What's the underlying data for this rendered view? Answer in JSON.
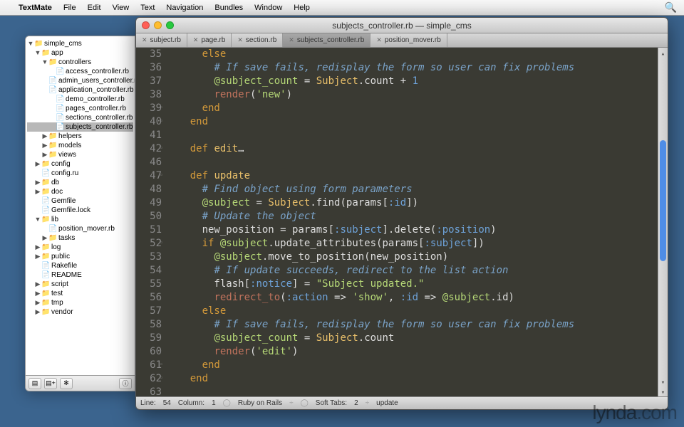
{
  "menubar": {
    "app_name": "TextMate",
    "items": [
      "File",
      "Edit",
      "View",
      "Text",
      "Navigation",
      "Bundles",
      "Window",
      "Help"
    ]
  },
  "drawer": {
    "tree": [
      {
        "d": 0,
        "arrow": "▼",
        "icon": "📁",
        "label": "simple_cms"
      },
      {
        "d": 1,
        "arrow": "▼",
        "icon": "📁",
        "label": "app"
      },
      {
        "d": 2,
        "arrow": "▼",
        "icon": "📁",
        "label": "controllers"
      },
      {
        "d": 3,
        "arrow": "",
        "icon": "📄",
        "label": "access_controller.rb"
      },
      {
        "d": 3,
        "arrow": "",
        "icon": "📄",
        "label": "admin_users_controller.rb"
      },
      {
        "d": 3,
        "arrow": "",
        "icon": "📄",
        "label": "application_controller.rb"
      },
      {
        "d": 3,
        "arrow": "",
        "icon": "📄",
        "label": "demo_controller.rb"
      },
      {
        "d": 3,
        "arrow": "",
        "icon": "📄",
        "label": "pages_controller.rb"
      },
      {
        "d": 3,
        "arrow": "",
        "icon": "📄",
        "label": "sections_controller.rb"
      },
      {
        "d": 3,
        "arrow": "",
        "icon": "📄",
        "label": "subjects_controller.rb",
        "selected": true
      },
      {
        "d": 2,
        "arrow": "▶",
        "icon": "📁",
        "label": "helpers"
      },
      {
        "d": 2,
        "arrow": "▶",
        "icon": "📁",
        "label": "models"
      },
      {
        "d": 2,
        "arrow": "▶",
        "icon": "📁",
        "label": "views"
      },
      {
        "d": 1,
        "arrow": "▶",
        "icon": "📁",
        "label": "config"
      },
      {
        "d": 1,
        "arrow": "",
        "icon": "📄",
        "label": "config.ru"
      },
      {
        "d": 1,
        "arrow": "▶",
        "icon": "📁",
        "label": "db"
      },
      {
        "d": 1,
        "arrow": "▶",
        "icon": "📁",
        "label": "doc"
      },
      {
        "d": 1,
        "arrow": "",
        "icon": "📄",
        "label": "Gemfile"
      },
      {
        "d": 1,
        "arrow": "",
        "icon": "📄",
        "label": "Gemfile.lock"
      },
      {
        "d": 1,
        "arrow": "▼",
        "icon": "📁",
        "label": "lib"
      },
      {
        "d": 2,
        "arrow": "",
        "icon": "📄",
        "label": "position_mover.rb"
      },
      {
        "d": 2,
        "arrow": "▶",
        "icon": "📁",
        "label": "tasks"
      },
      {
        "d": 1,
        "arrow": "▶",
        "icon": "📁",
        "label": "log"
      },
      {
        "d": 1,
        "arrow": "▶",
        "icon": "📁",
        "label": "public"
      },
      {
        "d": 1,
        "arrow": "",
        "icon": "📄",
        "label": "Rakefile"
      },
      {
        "d": 1,
        "arrow": "",
        "icon": "📄",
        "label": "README"
      },
      {
        "d": 1,
        "arrow": "▶",
        "icon": "📁",
        "label": "script"
      },
      {
        "d": 1,
        "arrow": "▶",
        "icon": "📁",
        "label": "test"
      },
      {
        "d": 1,
        "arrow": "▶",
        "icon": "📁",
        "label": "tmp"
      },
      {
        "d": 1,
        "arrow": "▶",
        "icon": "📁",
        "label": "vendor"
      }
    ],
    "toolbar": [
      "▤",
      "▤+",
      "✻",
      "ⓘ"
    ]
  },
  "editor": {
    "title": "subjects_controller.rb — simple_cms",
    "tabs": [
      {
        "label": "subject.rb"
      },
      {
        "label": "page.rb"
      },
      {
        "label": "section.rb"
      },
      {
        "label": "subjects_controller.rb",
        "active": true
      },
      {
        "label": "position_mover.rb"
      }
    ],
    "lines": [
      {
        "n": 35,
        "tokens": [
          [
            "      ",
            "plain"
          ],
          [
            "else",
            "else"
          ]
        ]
      },
      {
        "n": 36,
        "tokens": [
          [
            "        ",
            "plain"
          ],
          [
            "# If save fails, redisplay the form so user can fix problems",
            "comment"
          ]
        ]
      },
      {
        "n": 37,
        "tokens": [
          [
            "        ",
            "plain"
          ],
          [
            "@subject_count",
            "var"
          ],
          [
            " = ",
            "plain"
          ],
          [
            "Subject",
            "const"
          ],
          [
            ".count + ",
            "plain"
          ],
          [
            "1",
            "num"
          ]
        ]
      },
      {
        "n": 38,
        "tokens": [
          [
            "        ",
            "plain"
          ],
          [
            "render",
            "call"
          ],
          [
            "(",
            "plain"
          ],
          [
            "'new'",
            "str"
          ],
          [
            ")",
            "plain"
          ]
        ]
      },
      {
        "n": 39,
        "fold": true,
        "tokens": [
          [
            "      ",
            "plain"
          ],
          [
            "end",
            "kw"
          ]
        ]
      },
      {
        "n": 40,
        "fold": true,
        "tokens": [
          [
            "    ",
            "plain"
          ],
          [
            "end",
            "kw"
          ]
        ]
      },
      {
        "n": 41,
        "tokens": [
          [
            "",
            "plain"
          ]
        ]
      },
      {
        "n": 42,
        "fold": true,
        "tokens": [
          [
            "    ",
            "plain"
          ],
          [
            "def",
            "kw"
          ],
          [
            " ",
            "plain"
          ],
          [
            "edit",
            "def"
          ],
          [
            "…",
            "plain"
          ]
        ]
      },
      {
        "n": 46,
        "tokens": [
          [
            "",
            "plain"
          ]
        ]
      },
      {
        "n": 47,
        "fold": true,
        "tokens": [
          [
            "    ",
            "plain"
          ],
          [
            "def",
            "kw"
          ],
          [
            " ",
            "plain"
          ],
          [
            "update",
            "def"
          ]
        ]
      },
      {
        "n": 48,
        "tokens": [
          [
            "      ",
            "plain"
          ],
          [
            "# Find object using form parameters",
            "comment"
          ]
        ]
      },
      {
        "n": 49,
        "tokens": [
          [
            "      ",
            "plain"
          ],
          [
            "@subject",
            "var"
          ],
          [
            " = ",
            "plain"
          ],
          [
            "Subject",
            "const"
          ],
          [
            ".find(params[",
            "plain"
          ],
          [
            ":id",
            "sym"
          ],
          [
            "])",
            "plain"
          ]
        ]
      },
      {
        "n": 50,
        "tokens": [
          [
            "      ",
            "plain"
          ],
          [
            "# Update the object",
            "comment"
          ]
        ]
      },
      {
        "n": 51,
        "tokens": [
          [
            "      new_position = params[",
            "plain"
          ],
          [
            ":subject",
            "sym"
          ],
          [
            "].delete(",
            "plain"
          ],
          [
            ":position",
            "sym"
          ],
          [
            ")",
            "plain"
          ]
        ]
      },
      {
        "n": 52,
        "fold": true,
        "tokens": [
          [
            "      ",
            "plain"
          ],
          [
            "if",
            "kw"
          ],
          [
            " ",
            "plain"
          ],
          [
            "@subject",
            "var"
          ],
          [
            ".update_attributes(params[",
            "plain"
          ],
          [
            ":subject",
            "sym"
          ],
          [
            "])",
            "plain"
          ]
        ]
      },
      {
        "n": 53,
        "tokens": [
          [
            "        ",
            "plain"
          ],
          [
            "@subject",
            "var"
          ],
          [
            ".move_to_position(new_position)",
            "plain"
          ]
        ]
      },
      {
        "n": 54,
        "tokens": [
          [
            "        ",
            "plain"
          ],
          [
            "# If update succeeds, redirect to the list action",
            "comment"
          ]
        ]
      },
      {
        "n": 55,
        "tokens": [
          [
            "        flash[",
            "plain"
          ],
          [
            ":notice",
            "sym"
          ],
          [
            "] = ",
            "plain"
          ],
          [
            "\"Subject updated.\"",
            "str"
          ]
        ]
      },
      {
        "n": 56,
        "tokens": [
          [
            "        ",
            "plain"
          ],
          [
            "redirect_to",
            "redir"
          ],
          [
            "(",
            "plain"
          ],
          [
            ":action",
            "sym"
          ],
          [
            " => ",
            "plain"
          ],
          [
            "'show'",
            "str"
          ],
          [
            ", ",
            "plain"
          ],
          [
            ":id",
            "sym"
          ],
          [
            " => ",
            "plain"
          ],
          [
            "@subject",
            "var"
          ],
          [
            ".id)",
            "plain"
          ]
        ]
      },
      {
        "n": 57,
        "tokens": [
          [
            "      ",
            "plain"
          ],
          [
            "else",
            "else"
          ]
        ]
      },
      {
        "n": 58,
        "tokens": [
          [
            "        ",
            "plain"
          ],
          [
            "# If save fails, redisplay the form so user can fix problems",
            "comment"
          ]
        ]
      },
      {
        "n": 59,
        "tokens": [
          [
            "        ",
            "plain"
          ],
          [
            "@subject_count",
            "var"
          ],
          [
            " = ",
            "plain"
          ],
          [
            "Subject",
            "const"
          ],
          [
            ".count",
            "plain"
          ]
        ]
      },
      {
        "n": 60,
        "tokens": [
          [
            "        ",
            "plain"
          ],
          [
            "render",
            "call"
          ],
          [
            "(",
            "plain"
          ],
          [
            "'edit'",
            "str"
          ],
          [
            ")",
            "plain"
          ]
        ]
      },
      {
        "n": 61,
        "fold": true,
        "tokens": [
          [
            "      ",
            "plain"
          ],
          [
            "end",
            "kw"
          ]
        ]
      },
      {
        "n": 62,
        "fold": true,
        "tokens": [
          [
            "    ",
            "plain"
          ],
          [
            "end",
            "kw"
          ]
        ]
      },
      {
        "n": 63,
        "tokens": [
          [
            "",
            "plain"
          ]
        ]
      }
    ],
    "status": {
      "line_label": "Line:",
      "line": "54",
      "col_label": "Column:",
      "col": "1",
      "lang": "Ruby on Rails",
      "tabs_label": "Soft Tabs:",
      "tabs": "2",
      "action": "update"
    }
  },
  "watermark": {
    "brand": "lynda",
    "suffix": ".com"
  }
}
